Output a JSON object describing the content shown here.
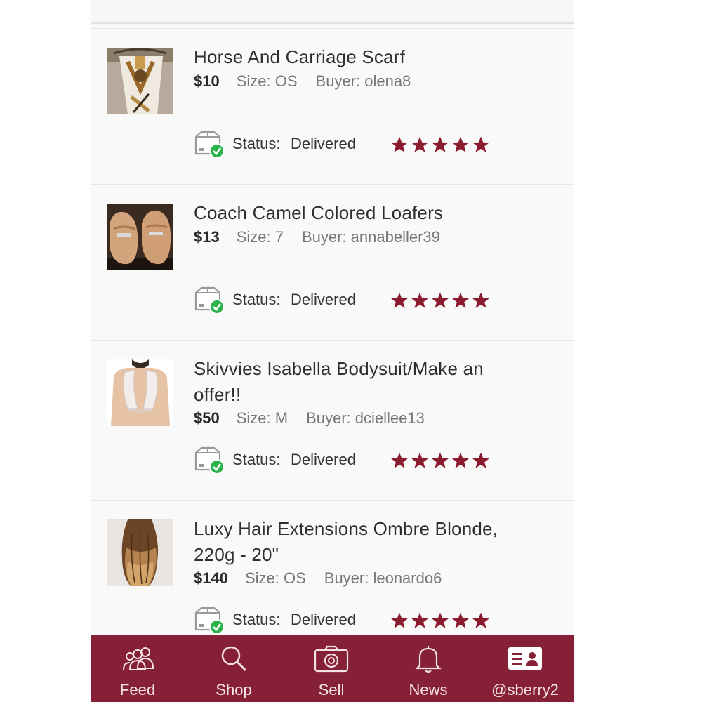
{
  "colors": {
    "accent": "#862036",
    "star": "#8b1c2f",
    "check": "#2bb24c"
  },
  "status_label": "Status:",
  "items": [
    {
      "title_line1": "Horse And Carriage Scarf",
      "title_line2": "",
      "price": "$10",
      "size": "Size: OS",
      "buyer": "Buyer: olena8",
      "status": "Delivered",
      "rating": 5,
      "thumb_icon": "scarf-photo"
    },
    {
      "title_line1": "Coach Camel Colored Loafers",
      "title_line2": "",
      "price": "$13",
      "size": "Size: 7",
      "buyer": "Buyer: annabeller39",
      "status": "Delivered",
      "rating": 5,
      "thumb_icon": "loafers-photo"
    },
    {
      "title_line1": "Skivvies Isabella Bodysuit/Make an",
      "title_line2": "offer!!",
      "price": "$50",
      "size": "Size: M",
      "buyer": "Buyer: dciellee13",
      "status": "Delivered",
      "rating": 5,
      "thumb_icon": "bodysuit-photo"
    },
    {
      "title_line1": "Luxy Hair Extensions Ombre Blonde,",
      "title_line2": "220g - 20\"",
      "price": "$140",
      "size": "Size: OS",
      "buyer": "Buyer: leonardo6",
      "status": "Delivered",
      "rating": 5,
      "thumb_icon": "hair-photo"
    }
  ],
  "tabs": [
    {
      "label": "Feed",
      "icon": "people-icon"
    },
    {
      "label": "Shop",
      "icon": "search-icon"
    },
    {
      "label": "Sell",
      "icon": "camera-icon"
    },
    {
      "label": "News",
      "icon": "bell-icon"
    },
    {
      "label": "@sberry2",
      "icon": "profile-card-icon"
    }
  ]
}
